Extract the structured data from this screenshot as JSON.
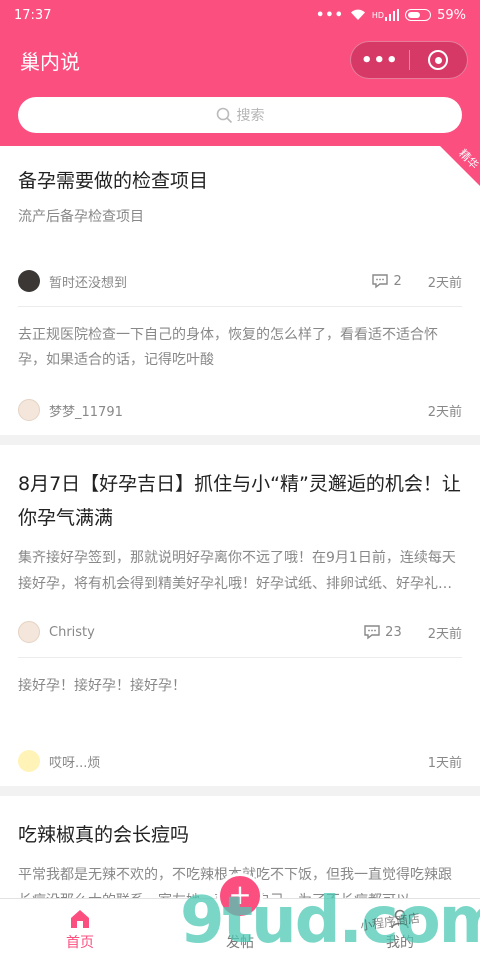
{
  "status": {
    "time": "17:37",
    "signal_badge": "HD",
    "battery": "59%"
  },
  "header": {
    "title": "巢内说",
    "more": "•••"
  },
  "search": {
    "placeholder": "搜索"
  },
  "posts": [
    {
      "title": "备孕需要做的检查项目",
      "excerpt": "流产后备孕检查项目",
      "badge": "精华",
      "author": "暂时还没想到",
      "comments": "2",
      "time": "2天前",
      "reply": {
        "text": "去正规医院检查一下自己的身体，恢复的怎么样了，看看适不适合怀孕，如果适合的话，记得吃叶酸",
        "author": "梦梦_11791",
        "time": "2天前"
      }
    },
    {
      "title": "8月7日【好孕吉日】抓住与小“精”灵邂逅的机会！让你孕气满满",
      "excerpt": "集齐接好孕签到，那就说明好孕离你不远了哦！在9月1日前，连续每天接好孕，将有机会得到精美好孕礼哦！好孕试纸、排卵试纸、好孕礼盒等你拿！",
      "author": "Christy",
      "comments": "23",
      "time": "2天前",
      "reply": {
        "text": "接好孕！接好孕！接好孕！",
        "author": "哎呀...烦",
        "time": "1天前"
      }
    },
    {
      "title": "吃辣椒真的会长痘吗",
      "excerpt": "平常我都是无辣不欢的，不吃辣根本就吃不下饭，但我一直觉得吃辣跟长痘没那么大的联系，室友她一直控制自己，为了不长痘都可以"
    }
  ],
  "tabs": [
    {
      "label": "首页"
    },
    {
      "label": "发帖"
    },
    {
      "label": "我的"
    }
  ],
  "watermark": {
    "main": "9tud.com",
    "small": "小程序商店"
  },
  "colors": {
    "brand": "#fb4f80",
    "watermark": "#4ec8b4"
  }
}
